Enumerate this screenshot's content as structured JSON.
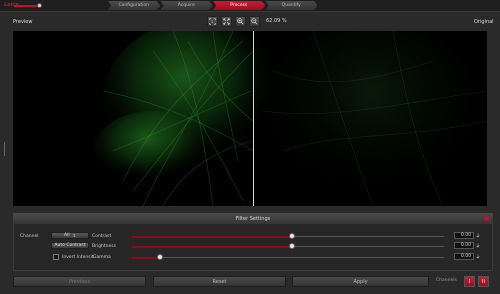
{
  "app": {
    "logo_text": "Leica"
  },
  "wizard": {
    "steps": [
      {
        "label": "Configuration",
        "active": false
      },
      {
        "label": "Acquire",
        "active": false
      },
      {
        "label": "Process",
        "active": true
      },
      {
        "label": "Quantify",
        "active": false
      }
    ]
  },
  "preview": {
    "left_label": "Preview",
    "right_label": "Original",
    "zoom_text": "62.09 %",
    "toolbar_icons": [
      "fit-to-window-icon",
      "fullscreen-icon",
      "zoom-in-icon",
      "zoom-out-icon"
    ]
  },
  "filter_settings": {
    "title": "Filter Settings",
    "channel_label": "Channel",
    "channel_value": "All",
    "auto_contrast_label": "Auto Contrast",
    "invert_label": "Invert Intensit",
    "invert_checked": false,
    "sliders": [
      {
        "name": "Contrast",
        "value": "0.00",
        "level": 0.5
      },
      {
        "name": "Brightness",
        "value": "0.00",
        "level": 0.5
      },
      {
        "name": "Gamma",
        "value": "0.00",
        "level": 0.0
      }
    ]
  },
  "actions": {
    "previous": "Previous",
    "reset": "Reset",
    "apply": "Apply",
    "channels_label": "Channels"
  },
  "colors": {
    "accent": "#c8102e",
    "background": "#2a2a2a",
    "image_signal": "#2e9e2e"
  }
}
